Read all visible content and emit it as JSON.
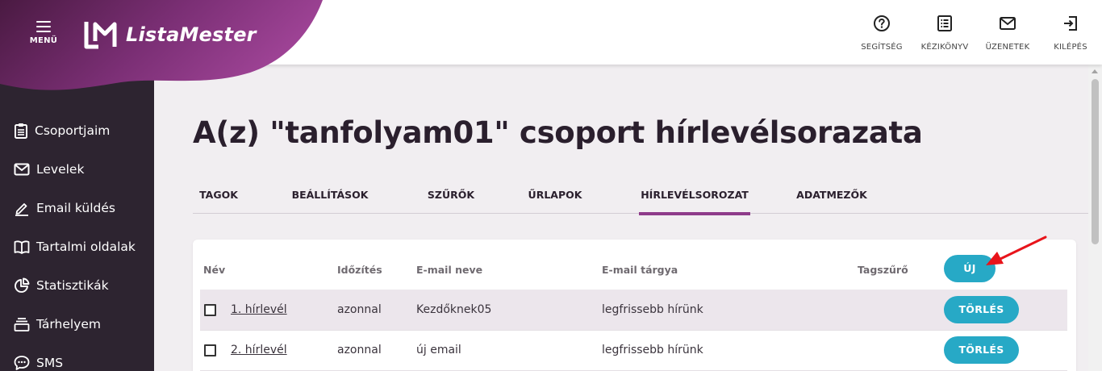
{
  "header": {
    "menu_label": "MENÜ",
    "brand": "ListaMester",
    "actions": [
      {
        "label": "SEGÍTSÉG",
        "icon": "help-circle-icon"
      },
      {
        "label": "KÉZIKÖNYV",
        "icon": "manual-list-icon"
      },
      {
        "label": "ÜZENETEK",
        "icon": "envelope-icon"
      },
      {
        "label": "KILÉPÉS",
        "icon": "logout-icon"
      }
    ]
  },
  "sidebar": {
    "items": [
      {
        "label": "Csoportjaim",
        "icon": "clipboard-icon"
      },
      {
        "label": "Levelek",
        "icon": "mail-icon"
      },
      {
        "label": "Email küldés",
        "icon": "pencil-icon"
      },
      {
        "label": "Tartalmi oldalak",
        "icon": "book-icon"
      },
      {
        "label": "Statisztikák",
        "icon": "pie-chart-icon"
      },
      {
        "label": "Tárhelyem",
        "icon": "storage-icon"
      },
      {
        "label": "SMS",
        "icon": "chat-bubble-icon"
      }
    ]
  },
  "page": {
    "title": "A(z) \"tanfolyam01\" csoport hírlevélsorazata",
    "tabs": [
      {
        "label": "TAGOK",
        "active": false
      },
      {
        "label": "BEÁLLÍTÁSOK",
        "active": false
      },
      {
        "label": "SZŰRŐK",
        "active": false
      },
      {
        "label": "ŰRLAPOK",
        "active": false
      },
      {
        "label": "HÍRLEVÉLSOROZAT",
        "active": true
      },
      {
        "label": "ADATMEZŐK",
        "active": false
      }
    ]
  },
  "table": {
    "columns": [
      "Név",
      "Időzítés",
      "E-mail neve",
      "E-mail tárgya",
      "Tagszűrő"
    ],
    "new_button": "ÚJ",
    "rows": [
      {
        "name": "1. hírlevél",
        "timing": "azonnal",
        "email_name": "Kezdőknek05",
        "subject": "legfrissebb hírünk",
        "tag_filter": "",
        "delete_label": "TÖRLÉS"
      },
      {
        "name": "2. hírlevél",
        "timing": "azonnal",
        "email_name": "új email",
        "subject": "legfrissebb hírünk",
        "tag_filter": "",
        "delete_label": "TÖRLÉS"
      }
    ]
  },
  "colors": {
    "brand_purple": "#8e3b8a",
    "sidebar_bg": "#2d2430",
    "button_teal": "#27a9c6",
    "annotation_arrow": "#e8141b"
  }
}
